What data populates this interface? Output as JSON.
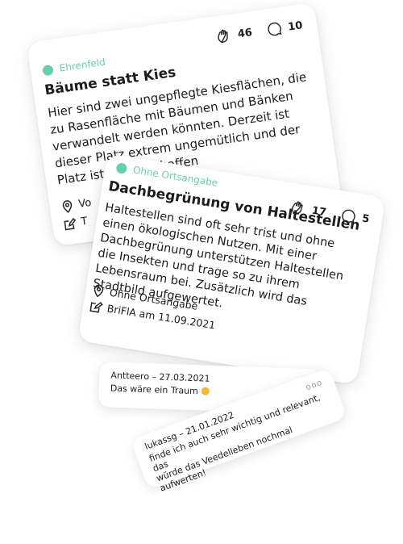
{
  "accent_color": "#66cfae",
  "cards": [
    {
      "district": "Ehrenfeld",
      "title": "Bäume statt Kies",
      "body": "Hier sind zwei ungepflegte Kiesflächen, die zu Rasenfläche mit Bäumen und Bänken verwandelt werden könnten. Derzeit ist dieser Platz extrem ungemütlich und der Platz ist wie geschaffen",
      "likes": "46",
      "comments": "10",
      "location": "Vo",
      "author": "T"
    },
    {
      "district": "Ohne Ortsangabe",
      "title": "Dachbegrünung von Haltestellen",
      "body": "Haltestellen sind oft sehr trist und ohne einen ökologischen Nutzen. Mit einer Dachbegrünung unterstützen Haltestellen die Insekten und trage so zu ihrem Lebensraum bei. Zusätzlich wird das Stadtbild aufgewertet.",
      "likes": "17",
      "comments": "5",
      "location": "Ohne Ortsangabe",
      "author": "BriFlA am 11.09.2021"
    }
  ],
  "comments": [
    {
      "author": "Antteero – 27.03.2021",
      "text": "Das wäre ein Traum",
      "emoji": "smiling-face-emoji"
    },
    {
      "author": "lukassg – 21.01.2022",
      "text_line1": "finde ich auch sehr wichtig und relevant, das",
      "text_line2": "würde das Veedelleben nochmal aufwerten!",
      "more": "ooo"
    }
  ]
}
